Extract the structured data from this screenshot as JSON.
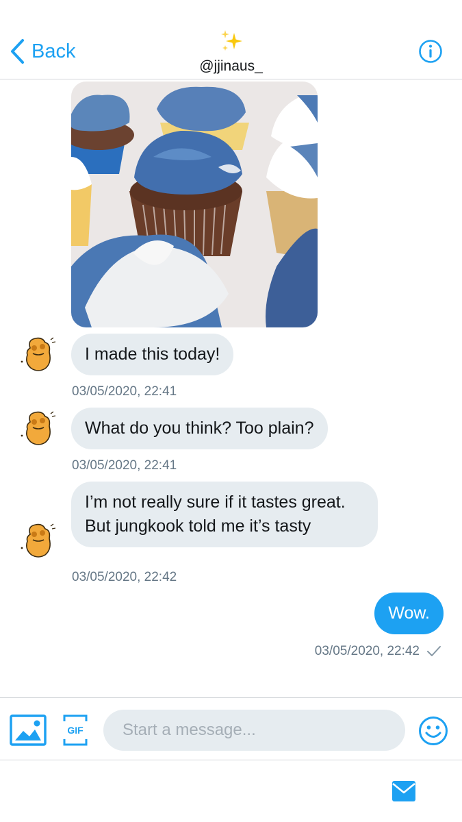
{
  "header": {
    "back_label": "Back",
    "handle": "@jjinaus_",
    "sparkle_icon": "sparkles-emoji",
    "info_icon": "info-icon"
  },
  "colors": {
    "accent": "#1da1f2",
    "bubble_received": "#e6ecf0",
    "timestamp": "#657786"
  },
  "conversation": {
    "photo": {
      "alt": "cupcakes-with-blue-and-white-frosting"
    },
    "messages": [
      {
        "sender": "them",
        "text": "I made this today!",
        "timestamp": "03/05/2020, 22:41"
      },
      {
        "sender": "them",
        "text": "What do you think? Too plain?",
        "timestamp": "03/05/2020, 22:41"
      },
      {
        "sender": "them",
        "text": "I’m not really sure if it tastes great. But jungkook told me it’s tasty",
        "timestamp": "03/05/2020, 22:42"
      },
      {
        "sender": "me",
        "text": "Wow.",
        "timestamp": "03/05/2020, 22:42",
        "status_icon": "checkmark-icon"
      }
    ]
  },
  "composer": {
    "placeholder": "Start a message...",
    "gif_label": "GIF",
    "media_icon": "image-icon",
    "emoji_icon": "smiley-icon"
  },
  "bottom_bar": {
    "icon": "envelope-icon"
  }
}
